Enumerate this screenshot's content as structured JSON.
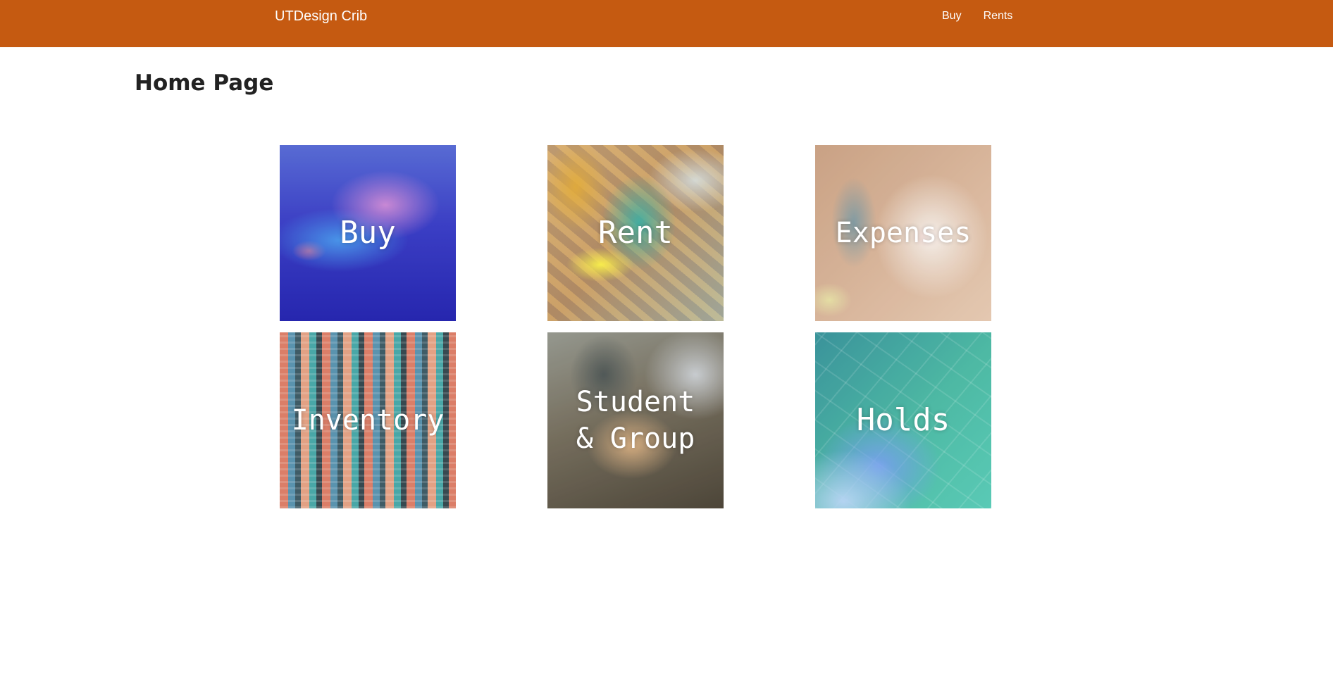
{
  "navbar": {
    "brand": "UTDesign Crib",
    "links": [
      {
        "label": "Buy"
      },
      {
        "label": "Rents"
      }
    ],
    "color": "#c55a11"
  },
  "page": {
    "title": "Home Page"
  },
  "tiles": [
    {
      "label": "Buy",
      "icon": "credit-card-photo"
    },
    {
      "label": "Rent",
      "icon": "tools-photo"
    },
    {
      "label": "Expenses",
      "icon": "charts-photo"
    },
    {
      "label": "Inventory",
      "icon": "containers-photo"
    },
    {
      "label": "Student & Group",
      "icon": "meeting-photo"
    },
    {
      "label": "Holds",
      "icon": "abstract-photo"
    }
  ]
}
